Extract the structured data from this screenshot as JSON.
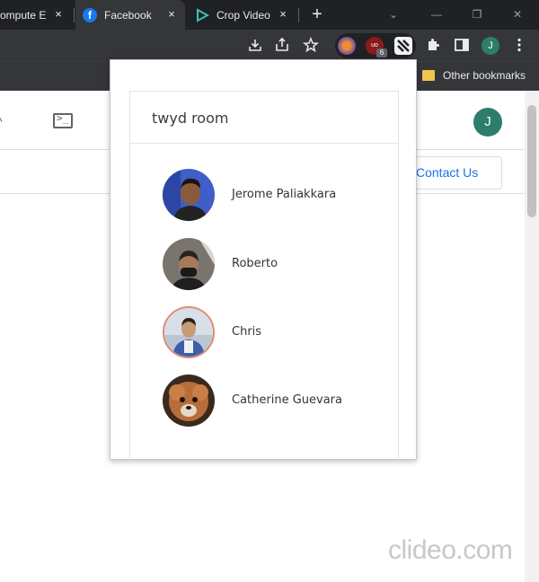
{
  "tabs": [
    {
      "title": "ompute E",
      "close_label": "×"
    },
    {
      "title": "Facebook",
      "close_label": "×"
    },
    {
      "title": "Crop Video",
      "close_label": "×"
    }
  ],
  "new_tab_label": "+",
  "profile_initial": "J",
  "extension_badge": "6",
  "bookmarks": {
    "other_label": "Other bookmarks"
  },
  "page": {
    "avatar_initial": "J",
    "contact_label": "Contact Us"
  },
  "popup": {
    "room_title": "twyd room",
    "members": [
      {
        "name": "Jerome Paliakkara"
      },
      {
        "name": "Roberto"
      },
      {
        "name": "Chris"
      },
      {
        "name": "Catherine Guevara"
      }
    ]
  },
  "watermark": "clideo.com",
  "colors": {
    "tab_strip": "#202124",
    "toolbar": "#35363a",
    "accent_blue": "#1a73e8",
    "profile_green": "#2e7d6a"
  },
  "icons": {
    "tab_favicons": [
      "compute-favicon",
      "facebook-icon",
      "clideo-play-icon"
    ],
    "toolbar": [
      "download-icon",
      "share-icon",
      "star-icon",
      "extension-1-icon",
      "ublock-icon",
      "twyd-extension-icon",
      "puzzle-icon",
      "side-panel-icon",
      "more-vert-icon"
    ],
    "page": [
      "chevron-up-icon",
      "terminal-icon"
    ]
  }
}
